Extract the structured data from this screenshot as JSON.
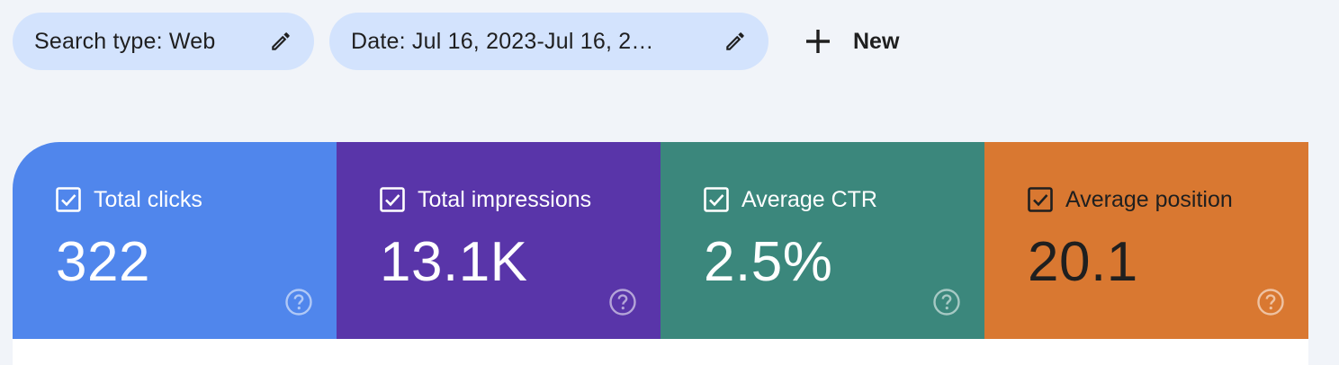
{
  "filters": {
    "chips": [
      {
        "label": "Search type: Web",
        "icon": "pencil-icon"
      },
      {
        "label": "Date: Jul 16, 2023-Jul 16, 2…",
        "icon": "pencil-icon"
      }
    ],
    "new_button": {
      "label": "New",
      "icon": "plus-icon"
    }
  },
  "metrics": [
    {
      "title": "Total clicks",
      "value": "322",
      "checked": true,
      "color": "#5086ec",
      "text_color": "#ffffff"
    },
    {
      "title": "Total impressions",
      "value": "13.1K",
      "checked": true,
      "color": "#5935a9",
      "text_color": "#ffffff"
    },
    {
      "title": "Average CTR",
      "value": "2.5%",
      "checked": true,
      "color": "#3b877c",
      "text_color": "#ffffff"
    },
    {
      "title": "Average position",
      "value": "20.1",
      "checked": true,
      "color": "#d97831",
      "text_color": "#1f1f1f"
    }
  ],
  "colors": {
    "page_background": "#f1f4f9",
    "chip_background": "#d3e3fd"
  }
}
